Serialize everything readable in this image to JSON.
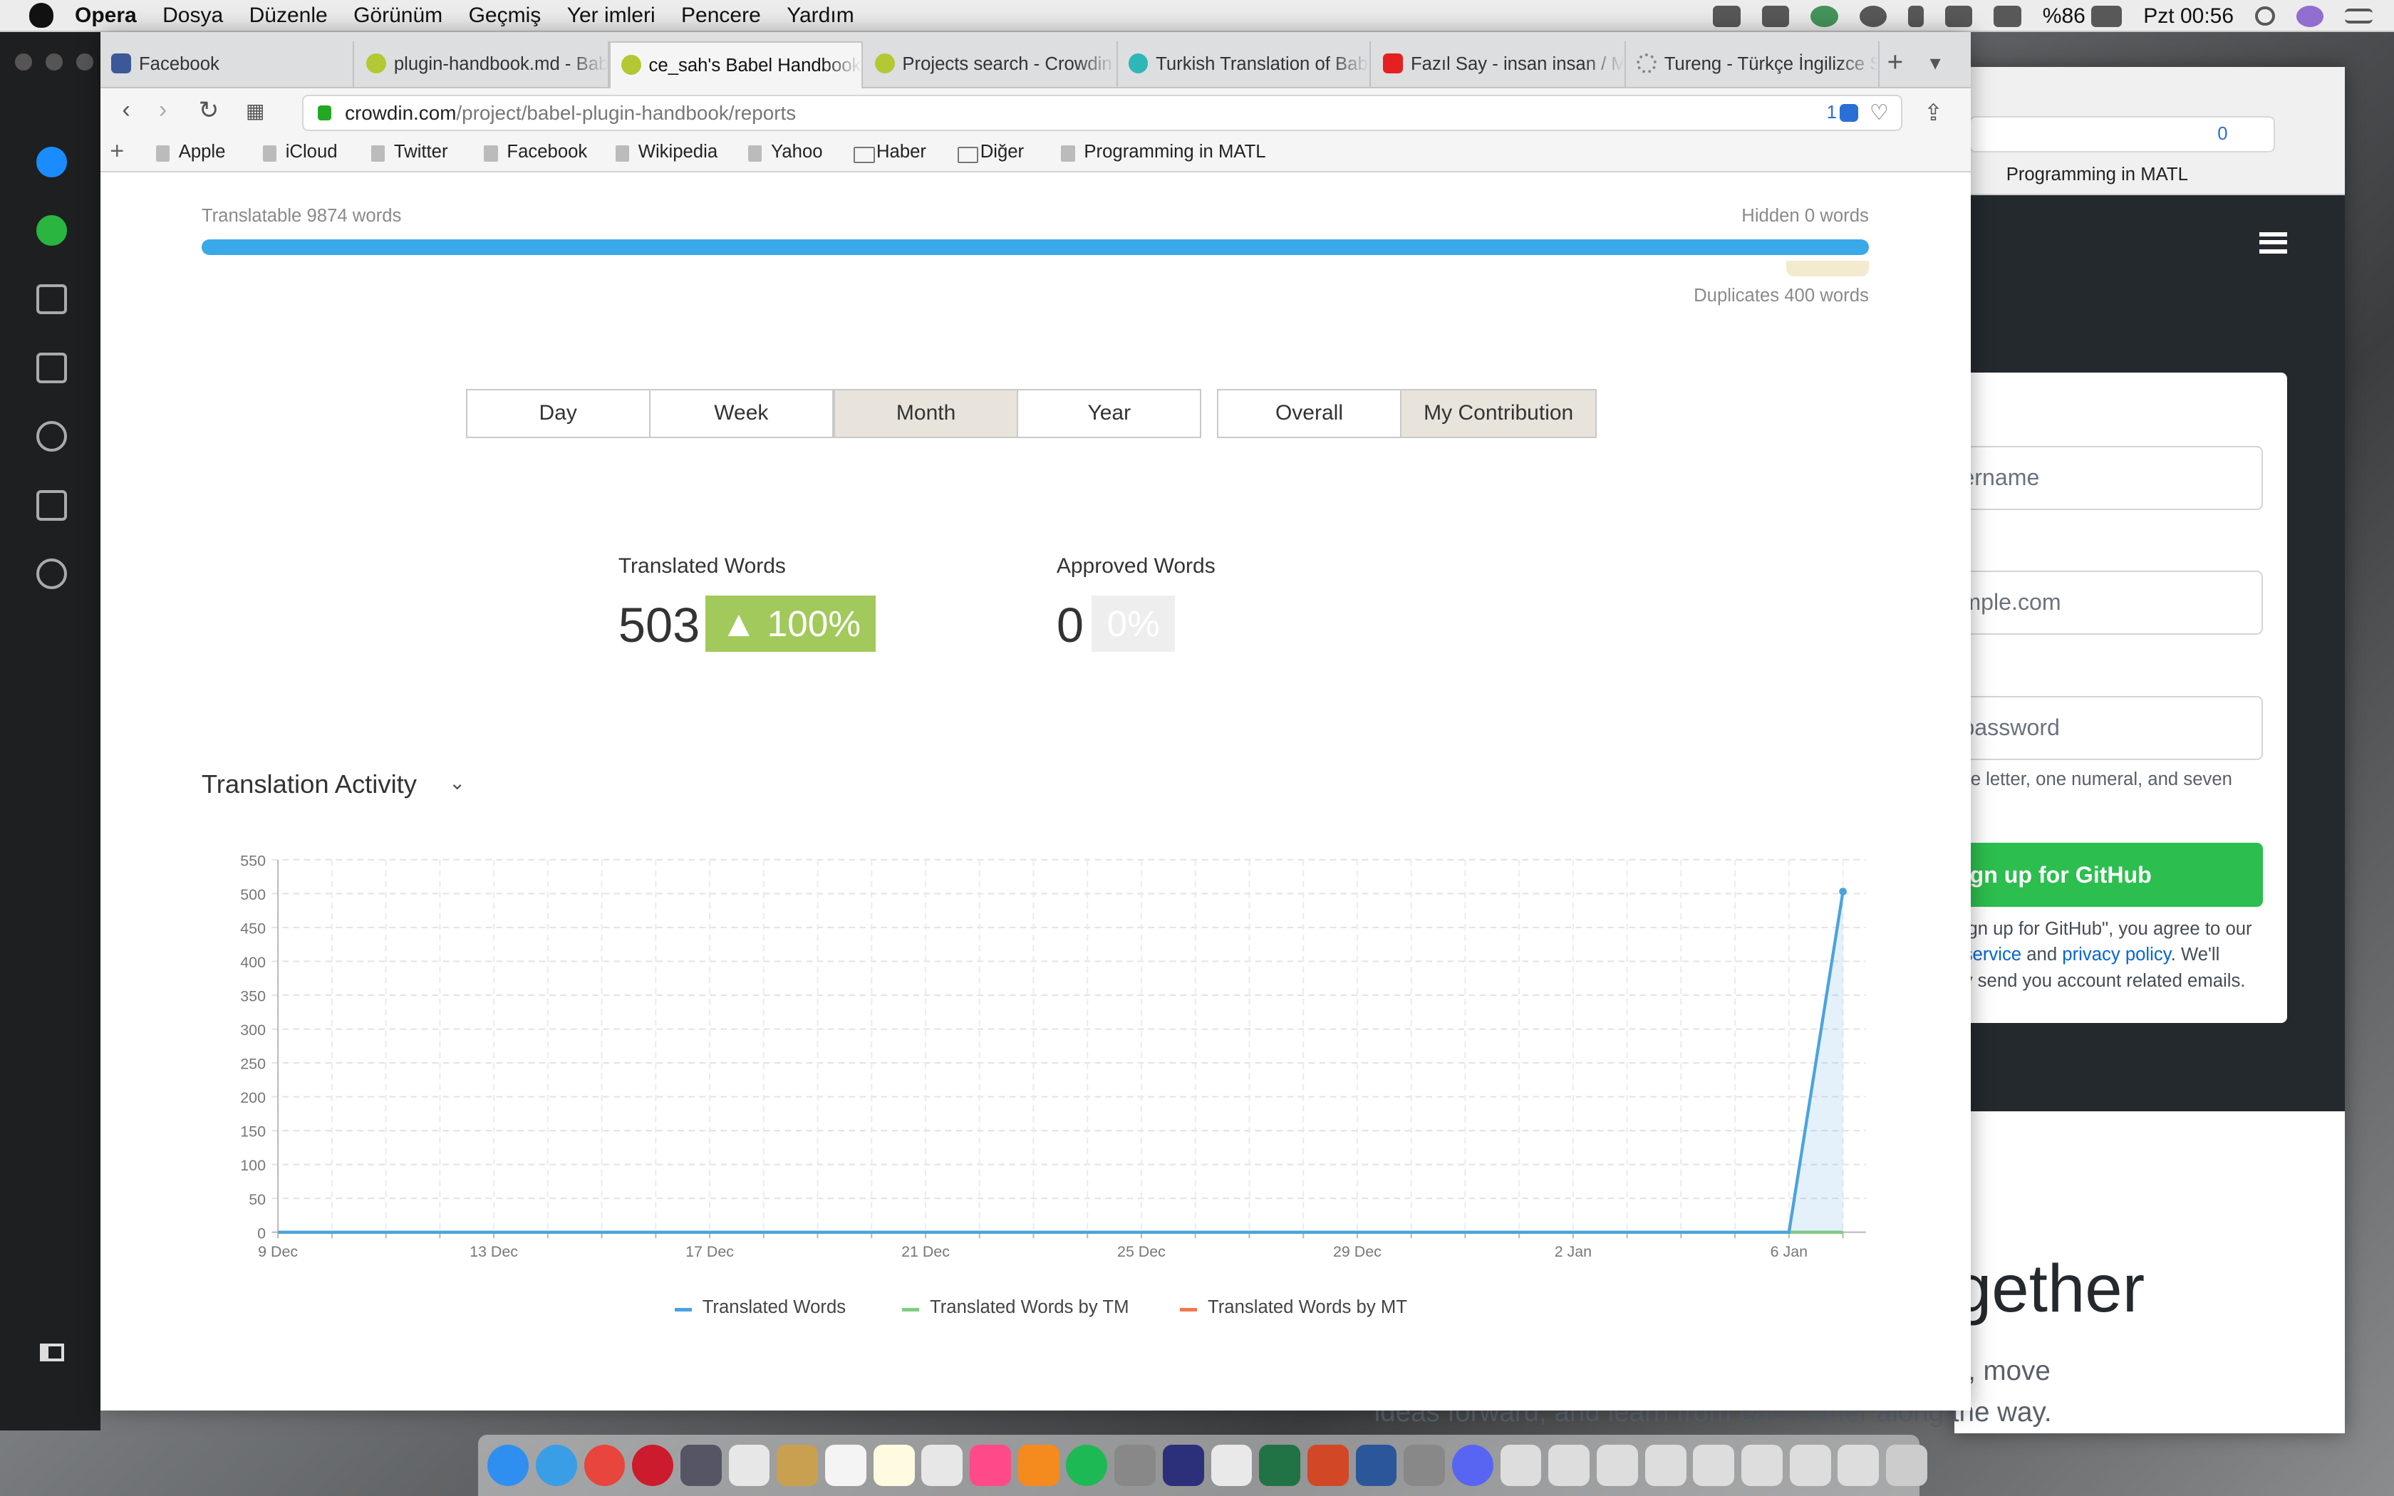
{
  "menubar": {
    "app": "Opera",
    "items": [
      "Dosya",
      "Düzenle",
      "Görünüm",
      "Geçmiş",
      "Yer imleri",
      "Pencere",
      "Yardım"
    ],
    "battery": "%86",
    "clock": "Pzt 00:56"
  },
  "tabs": [
    {
      "label": "Facebook",
      "icon": "facebook-icon"
    },
    {
      "label": "plugin-handbook.md - Bab",
      "icon": "crowdin-icon"
    },
    {
      "label": "ce_sah's Babel Handbook T",
      "icon": "crowdin-icon",
      "active": true
    },
    {
      "label": "Projects search - Crowdin",
      "icon": "crowdin-icon"
    },
    {
      "label": "Turkish Translation of Babe",
      "icon": "translate-icon"
    },
    {
      "label": "Fazıl Say - insan insan / Mu",
      "icon": "youtube-icon"
    },
    {
      "label": "Tureng - Türkçe İngilizce S",
      "icon": "loading-icon"
    }
  ],
  "url": {
    "domain": "crowdin.com",
    "path": "/project/babel-plugin-handbook/reports",
    "badge": "1"
  },
  "bookmarks": [
    "Apple",
    "iCloud",
    "Twitter",
    "Facebook",
    "Wikipedia",
    "Yahoo",
    "Haber",
    "Diğer",
    "Programming in MATL"
  ],
  "report": {
    "translatable": "Translatable 9874 words",
    "hidden": "Hidden 0 words",
    "duplicates": "Duplicates 400 words",
    "progress_fraction": 1.0,
    "period_buttons": [
      "Day",
      "Week",
      "Month",
      "Year"
    ],
    "period_selected": "Month",
    "scope_buttons": [
      "Overall",
      "My Contribution"
    ],
    "scope_selected": "My Contribution",
    "translated_label": "Translated Words",
    "translated_value": "503",
    "translated_change": "▲ 100%",
    "approved_label": "Approved Words",
    "approved_value": "0",
    "approved_change": "0%",
    "activity_title": "Translation Activity"
  },
  "chart_data": {
    "type": "area",
    "title": "",
    "xlabel": "",
    "ylabel": "",
    "ylim": [
      0,
      550
    ],
    "yticks": [
      0,
      50,
      100,
      150,
      200,
      250,
      300,
      350,
      400,
      450,
      500,
      550
    ],
    "xtick_labels": [
      "9 Dec",
      "13 Dec",
      "17 Dec",
      "21 Dec",
      "25 Dec",
      "29 Dec",
      "2 Jan",
      "6 Jan"
    ],
    "x": [
      "9 Dec",
      "10 Dec",
      "11 Dec",
      "12 Dec",
      "13 Dec",
      "14 Dec",
      "15 Dec",
      "16 Dec",
      "17 Dec",
      "18 Dec",
      "19 Dec",
      "20 Dec",
      "21 Dec",
      "22 Dec",
      "23 Dec",
      "24 Dec",
      "25 Dec",
      "26 Dec",
      "27 Dec",
      "28 Dec",
      "29 Dec",
      "30 Dec",
      "31 Dec",
      "1 Jan",
      "2 Jan",
      "3 Jan",
      "4 Jan",
      "5 Jan",
      "6 Jan",
      "7 Jan"
    ],
    "series": [
      {
        "name": "Translated Words",
        "color": "#4aa3df",
        "values": [
          0,
          0,
          0,
          0,
          0,
          0,
          0,
          0,
          0,
          0,
          0,
          0,
          0,
          0,
          0,
          0,
          0,
          0,
          0,
          0,
          0,
          0,
          0,
          0,
          0,
          0,
          0,
          0,
          0,
          503
        ]
      },
      {
        "name": "Translated Words by TM",
        "color": "#7fcf7f",
        "values": [
          0,
          0,
          0,
          0,
          0,
          0,
          0,
          0,
          0,
          0,
          0,
          0,
          0,
          0,
          0,
          0,
          0,
          0,
          0,
          0,
          0,
          0,
          0,
          0,
          0,
          0,
          0,
          0,
          0,
          0
        ]
      },
      {
        "name": "Translated Words by MT",
        "color": "#f07a50",
        "values": [
          0,
          0,
          0,
          0,
          0,
          0,
          0,
          0,
          0,
          0,
          0,
          0,
          0,
          0,
          0,
          0,
          0,
          0,
          0,
          0,
          0,
          0,
          0,
          0,
          0,
          0,
          0,
          0,
          0,
          0
        ]
      }
    ],
    "grid": true,
    "legend": "bottom"
  },
  "background_window": {
    "bookmark": "Programming in MATL",
    "url_badge": "0",
    "username_placeholder": "ername",
    "email_placeholder": "mple.com",
    "password_placeholder": "password",
    "password_hint": "he letter, one numeral, and seven",
    "signup_button": "ign up for GitHub",
    "terms_1": "ign up for GitHub\", you agree to our",
    "terms_link_1": "service",
    "terms_and": " and ",
    "terms_link_2": "privacy policy",
    "terms_2": ". We'll",
    "terms_3": "y send you account related emails.",
    "headline": "gether",
    "subline": "s, move",
    "bottom_line": "ideas forward, and learn from each other along the way."
  }
}
